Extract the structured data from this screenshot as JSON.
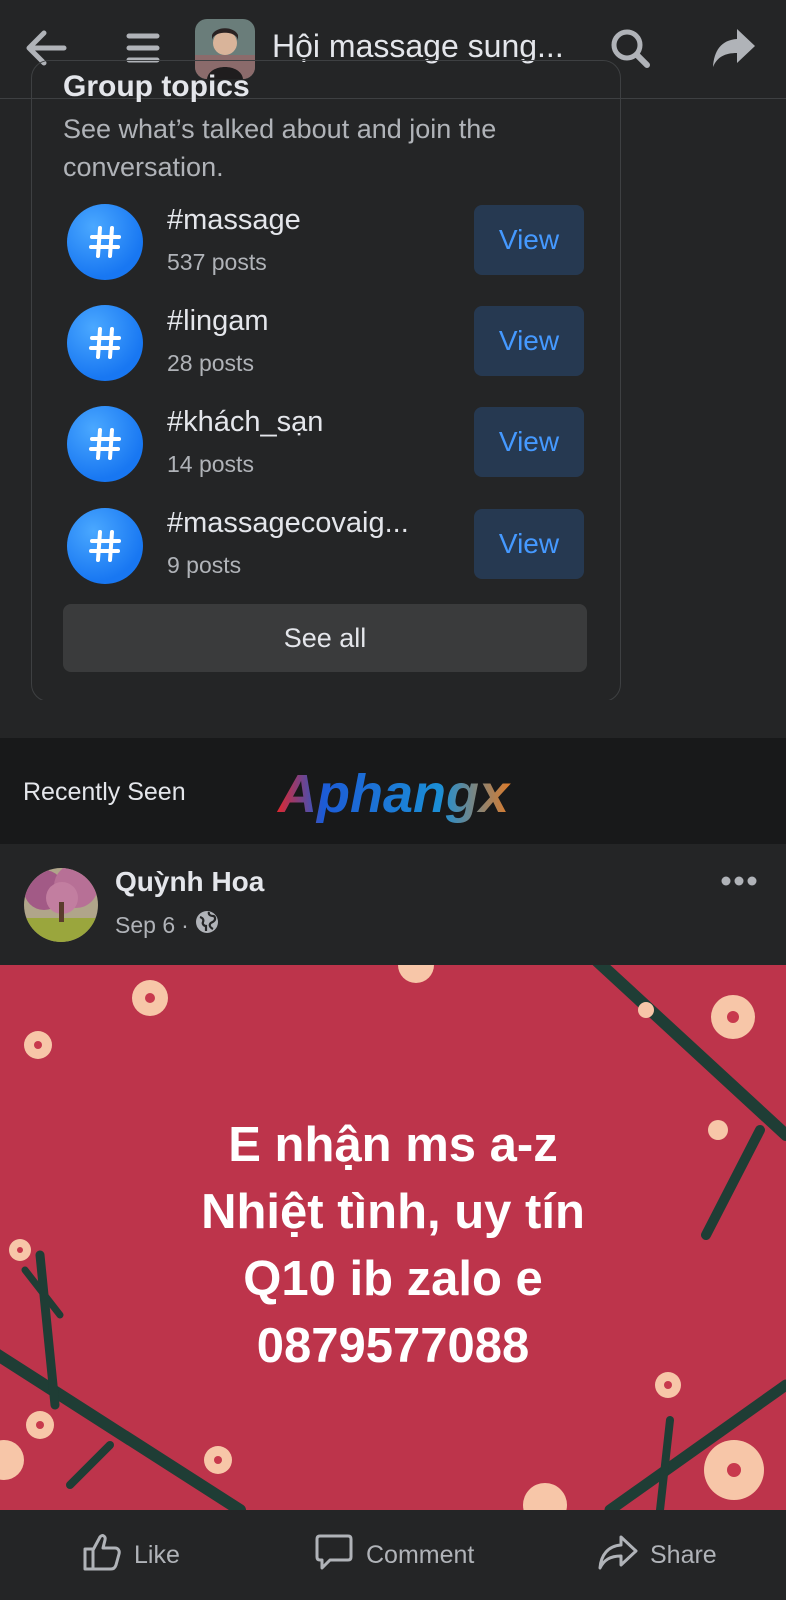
{
  "header": {
    "group_title": "Hội massage sung...",
    "icons": [
      "back-arrow-icon",
      "menu-icon",
      "search-icon",
      "share-arrow-icon"
    ]
  },
  "topics": {
    "heading": "Group topics",
    "subtitle": "See what’s talked about and join the conversation.",
    "items": [
      {
        "name": "#massage",
        "count": "537 posts",
        "button": "View"
      },
      {
        "name": "#lingam",
        "count": "28 posts",
        "button": "View"
      },
      {
        "name": "#khách_sạn",
        "count": "14 posts",
        "button": "View"
      },
      {
        "name": "#massagecovaig...",
        "count": "9 posts",
        "button": "View"
      }
    ],
    "see_all": "See all"
  },
  "recently_seen": {
    "label": "Recently Seen",
    "watermark": "Aphangx"
  },
  "post": {
    "author": "Quỳnh Hoa",
    "date": "Sep 6",
    "separator": "·",
    "image_text": {
      "line1": "E nhận ms a-z",
      "line2": "Nhiệt tình, uy tín",
      "line3": "Q10 ib zalo e",
      "line4": "0879577088"
    },
    "image_background": "#bd344b"
  },
  "actions": {
    "like": "Like",
    "comment": "Comment",
    "share": "Share"
  },
  "colors": {
    "background": "#242526",
    "accent_blue": "#4599ff",
    "hash_icon_blue": "#1877f2"
  }
}
